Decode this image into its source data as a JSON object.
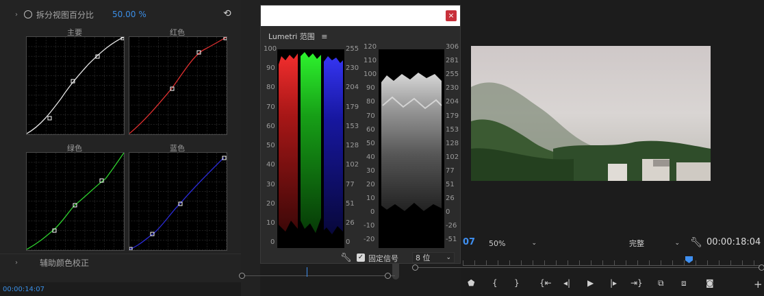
{
  "left_panel": {
    "split_label": "拆分视图百分比",
    "split_value": "50.00",
    "split_unit": "%",
    "curves": {
      "master": "主要",
      "red": "红色",
      "green": "绿色",
      "blue": "蓝色"
    },
    "aux_label": "辅助颜色校正",
    "timecode": "00:00:14:07"
  },
  "lumetri": {
    "title": "Lumetri 范围",
    "menu_icon": "hamburger-icon",
    "close": "×",
    "ticks_left": [
      "100",
      "90",
      "80",
      "70",
      "60",
      "50",
      "40",
      "30",
      "20",
      "10",
      "0"
    ],
    "ticks_mid": [
      "255",
      "230",
      "204",
      "179",
      "153",
      "128",
      "102",
      "77",
      "51",
      "26",
      "0"
    ],
    "ticks_left2": [
      "120",
      "110",
      "100",
      "90",
      "80",
      "70",
      "60",
      "50",
      "40",
      "30",
      "20",
      "10",
      "0",
      "-10",
      "-20"
    ],
    "ticks_right": [
      "306",
      "281",
      "255",
      "230",
      "204",
      "179",
      "153",
      "128",
      "102",
      "77",
      "51",
      "26",
      "0",
      "-26",
      "-51"
    ],
    "clamp_label": "固定信号",
    "bitdepth": "8 位"
  },
  "program": {
    "frame_partial": "07",
    "zoom": "50%",
    "quality": "完整",
    "timecode": "00:00:18:04"
  },
  "colors": {
    "accent": "#2d8ceb",
    "playhead": "#3f8ff0"
  }
}
